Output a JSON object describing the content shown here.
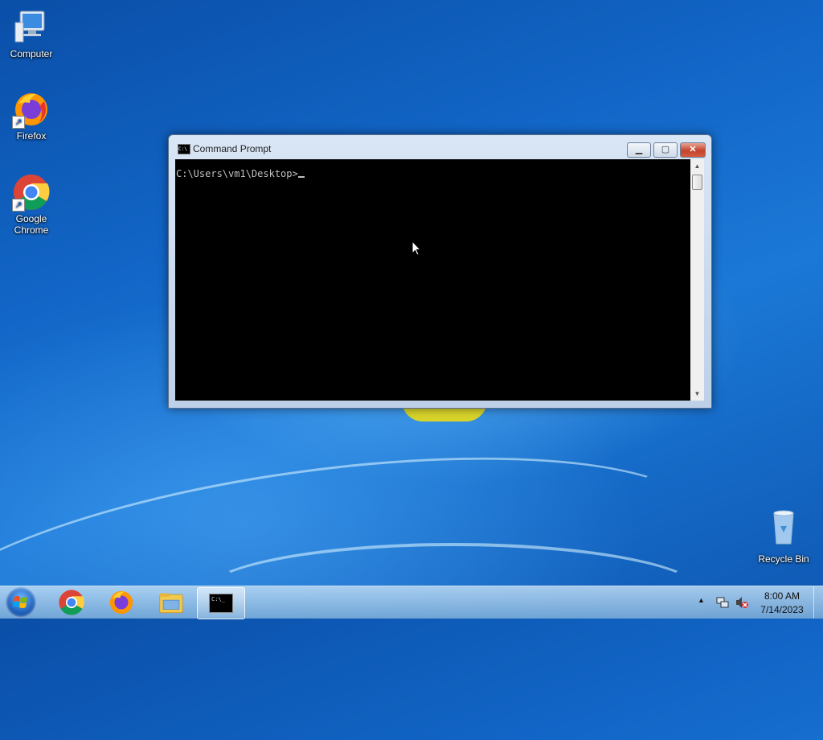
{
  "desktop": {
    "icons": [
      {
        "label": "Computer",
        "icon": "computer-icon"
      },
      {
        "label": "Firefox",
        "icon": "firefox-icon"
      },
      {
        "label": "Google Chrome",
        "icon": "chrome-icon"
      },
      {
        "label": "Recycle Bin",
        "icon": "recycle-bin-icon"
      }
    ]
  },
  "window": {
    "title": "Command Prompt",
    "icon": "cmd-icon",
    "icon_text": "C:\\",
    "controls": {
      "minimize": "minimize-icon",
      "maximize": "maximize-icon",
      "close": "close-icon"
    },
    "console_lines": [
      "C:\\Users\\vm1\\Desktop>"
    ]
  },
  "taskbar": {
    "start_icon": "windows-logo-icon",
    "apps": [
      "chrome-icon",
      "firefox-icon",
      "file-explorer-icon",
      "cmd-icon"
    ],
    "cmd_button_text": "C:\\_",
    "tray": {
      "time": "8:00 AM",
      "date": "7/14/2023",
      "icons": [
        "show-hidden-icons-icon",
        "network-icon",
        "volume-muted-icon"
      ]
    }
  },
  "colors": {
    "console_bg": "#000000",
    "console_text": "#c0c0c0",
    "desktop_blue": "#1266c7"
  }
}
